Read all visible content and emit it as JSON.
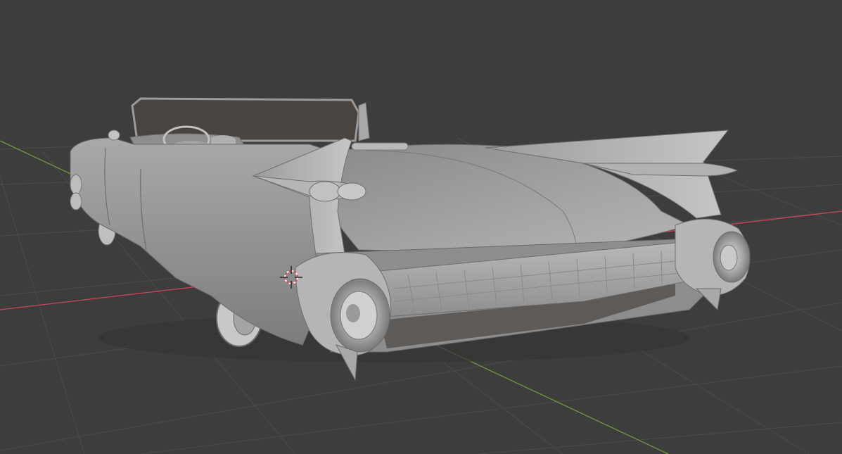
{
  "viewport": {
    "mode": "3d-solid-view",
    "background_color": "#3d3d3d",
    "grid_color": "#4a4a4a",
    "x_axis_color": "#c8484f",
    "y_axis_color": "#6f9a3a",
    "cursor_icon": "3d-cursor-icon",
    "object": "convertible-car-model"
  }
}
